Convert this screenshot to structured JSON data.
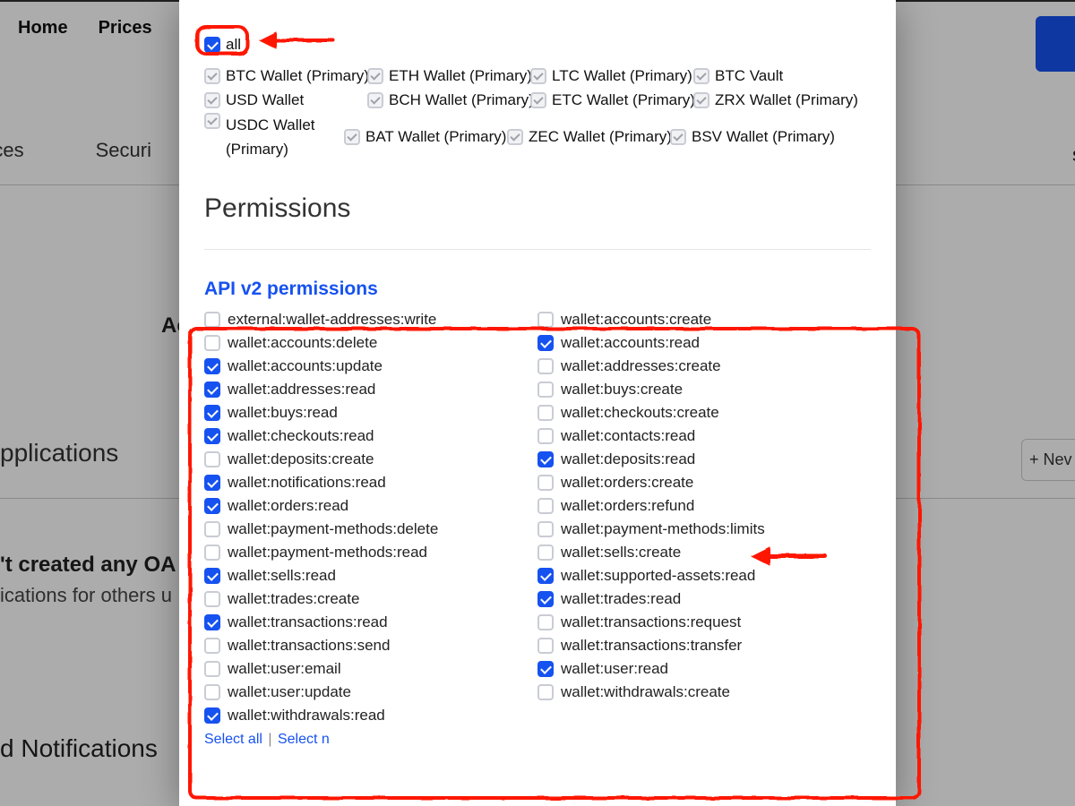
{
  "background": {
    "nav": {
      "home": "Home",
      "prices": "Prices"
    },
    "subnav": {
      "preferences": "eferences",
      "security": "Securi",
      "right_crumb": "s"
    },
    "accounts_header": "Ac",
    "applications_header": "pplications",
    "new_button": "+   Nev",
    "oauth_line1": "'t created any OA",
    "oauth_line2": "ications for others u",
    "notifications_header": "d Notifications"
  },
  "accounts": {
    "all_label": "all",
    "all_checked": true,
    "items": [
      {
        "label": "BTC Wallet (Primary)",
        "col": 0
      },
      {
        "label": "ETH Wallet (Primary)",
        "col": 1
      },
      {
        "label": "LTC Wallet (Primary)",
        "col": 2
      },
      {
        "label": "BTC Vault",
        "col": 3
      },
      {
        "label": "USD Wallet",
        "col": 0
      },
      {
        "label": "BCH Wallet (Primary)",
        "col": 1
      },
      {
        "label": "ETC Wallet (Primary)",
        "col": 2
      },
      {
        "label": "ZRX Wallet (Primary)",
        "col": 3
      },
      {
        "label": "USDC Wallet (Primary)",
        "col": 0
      },
      {
        "label": "BAT Wallet (Primary)",
        "col": 1
      },
      {
        "label": "ZEC Wallet (Primary)",
        "col": 2
      },
      {
        "label": "BSV Wallet (Primary)",
        "col": 3
      }
    ]
  },
  "permissions_title": "Permissions",
  "api_title": "API v2 permissions",
  "permissions": [
    {
      "label": "external:wallet-addresses:write",
      "checked": false
    },
    {
      "label": "wallet:accounts:create",
      "checked": false
    },
    {
      "label": "wallet:accounts:delete",
      "checked": false
    },
    {
      "label": "wallet:accounts:read",
      "checked": true
    },
    {
      "label": "wallet:accounts:update",
      "checked": true
    },
    {
      "label": "wallet:addresses:create",
      "checked": false
    },
    {
      "label": "wallet:addresses:read",
      "checked": true
    },
    {
      "label": "wallet:buys:create",
      "checked": false
    },
    {
      "label": "wallet:buys:read",
      "checked": true
    },
    {
      "label": "wallet:checkouts:create",
      "checked": false
    },
    {
      "label": "wallet:checkouts:read",
      "checked": true
    },
    {
      "label": "wallet:contacts:read",
      "checked": false
    },
    {
      "label": "wallet:deposits:create",
      "checked": false
    },
    {
      "label": "wallet:deposits:read",
      "checked": true
    },
    {
      "label": "wallet:notifications:read",
      "checked": true
    },
    {
      "label": "wallet:orders:create",
      "checked": false
    },
    {
      "label": "wallet:orders:read",
      "checked": true
    },
    {
      "label": "wallet:orders:refund",
      "checked": false
    },
    {
      "label": "wallet:payment-methods:delete",
      "checked": false
    },
    {
      "label": "wallet:payment-methods:limits",
      "checked": false
    },
    {
      "label": "wallet:payment-methods:read",
      "checked": false
    },
    {
      "label": "wallet:sells:create",
      "checked": false
    },
    {
      "label": "wallet:sells:read",
      "checked": true
    },
    {
      "label": "wallet:supported-assets:read",
      "checked": true
    },
    {
      "label": "wallet:trades:create",
      "checked": false
    },
    {
      "label": "wallet:trades:read",
      "checked": true
    },
    {
      "label": "wallet:transactions:read",
      "checked": true
    },
    {
      "label": "wallet:transactions:request",
      "checked": false
    },
    {
      "label": "wallet:transactions:send",
      "checked": false
    },
    {
      "label": "wallet:transactions:transfer",
      "checked": false
    },
    {
      "label": "wallet:user:email",
      "checked": false
    },
    {
      "label": "wallet:user:read",
      "checked": true
    },
    {
      "label": "wallet:user:update",
      "checked": false
    },
    {
      "label": "wallet:withdrawals:create",
      "checked": false
    },
    {
      "label": "wallet:withdrawals:read",
      "checked": true
    }
  ],
  "select_links": {
    "all": "Select all",
    "sep": "|",
    "none": "Select n"
  }
}
